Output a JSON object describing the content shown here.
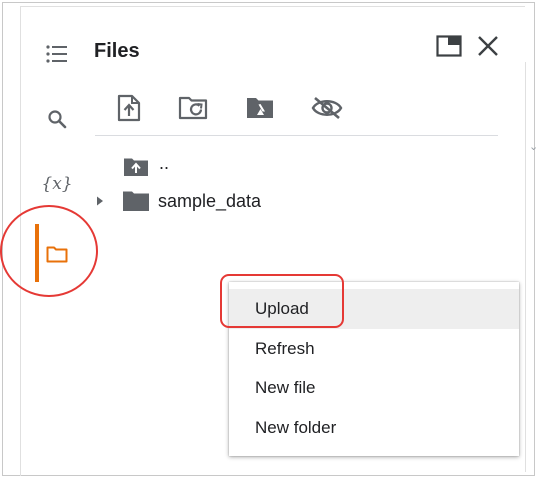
{
  "panel": {
    "title": "Files"
  },
  "sidebar": {
    "items": [
      {
        "name": "table-of-contents",
        "icon": "list-icon"
      },
      {
        "name": "search",
        "icon": "search-icon"
      },
      {
        "name": "variables",
        "icon": "variables-icon",
        "label": "{x}"
      },
      {
        "name": "files",
        "icon": "folder-icon",
        "active": true
      }
    ]
  },
  "header": {
    "buttons": [
      {
        "name": "dock-panel",
        "icon": "window-icon"
      },
      {
        "name": "close",
        "icon": "close-icon"
      }
    ]
  },
  "toolbar": {
    "buttons": [
      {
        "name": "upload",
        "icon": "upload-file-icon"
      },
      {
        "name": "refresh",
        "icon": "folder-refresh-icon"
      },
      {
        "name": "mount-drive",
        "icon": "drive-folder-icon"
      },
      {
        "name": "toggle-hidden",
        "icon": "eye-off-icon"
      }
    ]
  },
  "tree": {
    "parent_label": "..",
    "items": [
      {
        "label": "sample_data",
        "type": "folder",
        "expanded": false
      }
    ]
  },
  "context_menu": {
    "items": [
      {
        "label": "Upload",
        "highlighted": true
      },
      {
        "label": "Refresh"
      },
      {
        "label": "New file"
      },
      {
        "label": "New folder"
      }
    ]
  },
  "colors": {
    "accent": "#e8710a",
    "annotation": "#e53935",
    "icon": "#5f6368"
  }
}
